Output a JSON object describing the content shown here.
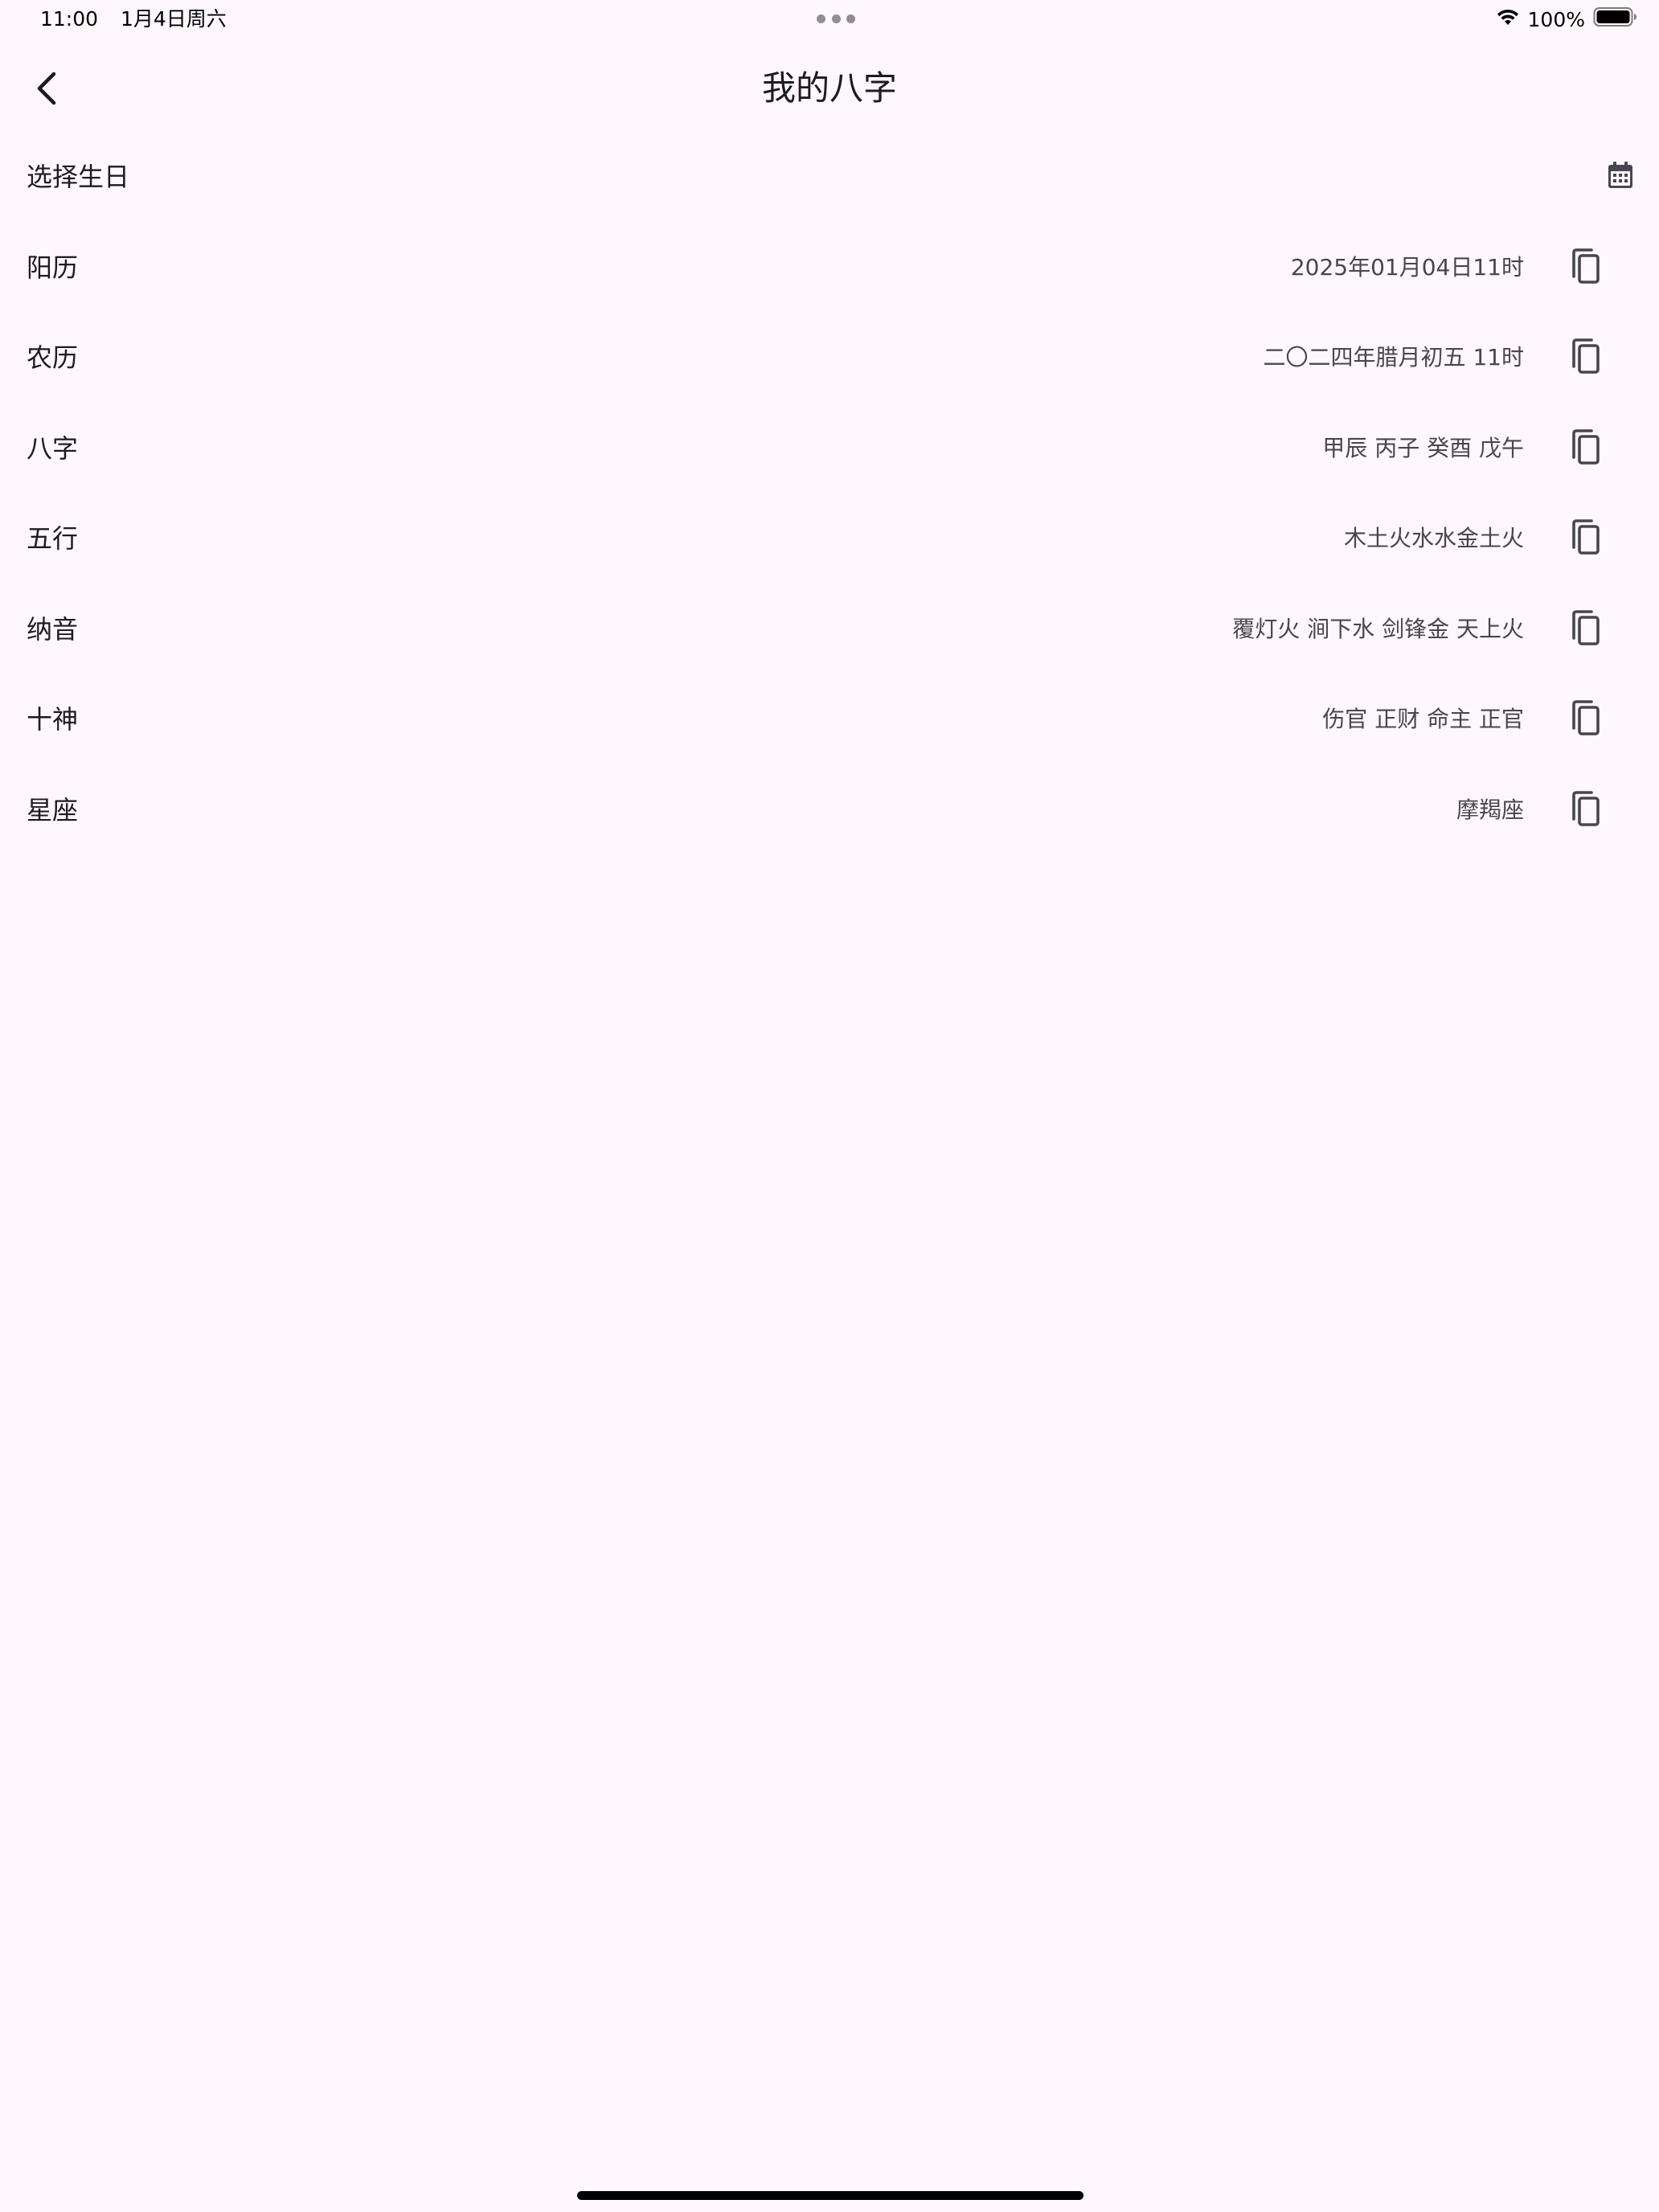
{
  "status_bar": {
    "time": "11:00",
    "date": "1月4日周六",
    "battery": "100%"
  },
  "app_bar": {
    "title": "我的八字"
  },
  "select_birthday": {
    "label": "选择生日",
    "icon": "calendar-icon"
  },
  "rows": [
    {
      "label": "阳历",
      "value": "2025年01月04日11时"
    },
    {
      "label": "农历",
      "value": "二〇二四年腊月初五 11时"
    },
    {
      "label": "八字",
      "value": "甲辰 丙子 癸酉 戊午"
    },
    {
      "label": "五行",
      "value": "木土火水水金土火"
    },
    {
      "label": "纳音",
      "value": "覆灯火 涧下水 剑锋金 天上火"
    },
    {
      "label": "十神",
      "value": "伤官 正财 命主 正官"
    },
    {
      "label": "星座",
      "value": "摩羯座"
    }
  ],
  "colors": {
    "background": "#fef7fd",
    "text_primary": "#1d1b20",
    "text_secondary": "#49454f"
  }
}
